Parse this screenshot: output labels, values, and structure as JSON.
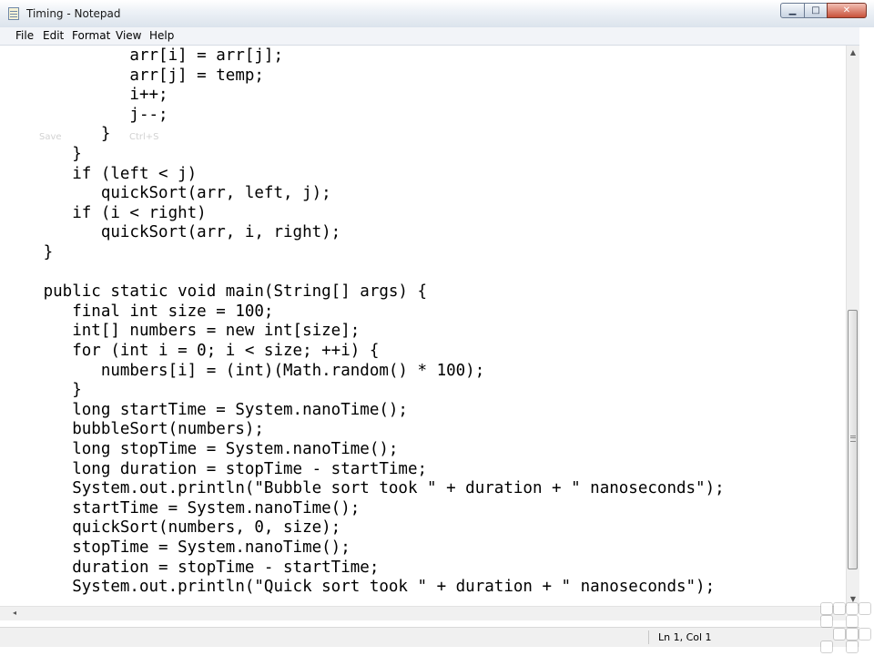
{
  "window": {
    "title": "Timing - Notepad",
    "controls": {
      "minimize": "▁",
      "maximize": "□",
      "close": "✕"
    }
  },
  "menu": [
    "File",
    "Edit",
    "Format",
    "View",
    "Help"
  ],
  "editor": {
    "lines": [
      "            arr[i] = arr[j];",
      "            arr[j] = temp;",
      "            i++;",
      "            j--;",
      "         }",
      "      }",
      "      if (left < j)",
      "         quickSort(arr, left, j);",
      "      if (i < right)",
      "         quickSort(arr, i, right);",
      "   }",
      "",
      "   public static void main(String[] args) {",
      "      final int size = 100;",
      "      int[] numbers = new int[size];",
      "      for (int i = 0; i < size; ++i) {",
      "         numbers[i] = (int)(Math.random() * 100);",
      "      }",
      "      long startTime = System.nanoTime();",
      "      bubbleSort(numbers);",
      "      long stopTime = System.nanoTime();",
      "      long duration = stopTime - startTime;",
      "      System.out.println(\"Bubble sort took \" + duration + \" nanoseconds\");",
      "      startTime = System.nanoTime();",
      "      quickSort(numbers, 0, size);",
      "      stopTime = System.nanoTime();",
      "      duration = stopTime - startTime;",
      "      System.out.println(\"Quick sort took \" + duration + \" nanoseconds\");"
    ],
    "ghost_menu": {
      "label": "Save",
      "shortcut": "Ctrl+S"
    }
  },
  "scrollbars": {
    "up": "▲",
    "down": "▼",
    "left": "◂"
  },
  "status": {
    "position": "Ln 1, Col 1"
  }
}
